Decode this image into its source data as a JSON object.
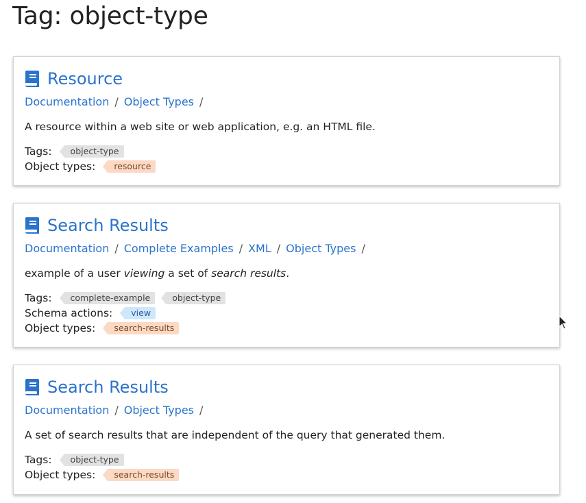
{
  "page": {
    "title": "Tag: object-type"
  },
  "cards": [
    {
      "icon": "book-icon",
      "title": "Resource",
      "breadcrumb": [
        "Documentation",
        "Object Types"
      ],
      "description": "A resource within a web site or web application, e.g. an HTML file.",
      "tags_label": "Tags:",
      "tags": [
        "object-type"
      ],
      "object_types_label": "Object types:",
      "object_types": [
        "resource"
      ]
    },
    {
      "icon": "book-icon",
      "title": "Search Results",
      "breadcrumb": [
        "Documentation",
        "Complete Examples",
        "XML",
        "Object Types"
      ],
      "description_parts": {
        "p1": "example of a user ",
        "em1": "viewing",
        "p2": " a set of ",
        "em2": "search results",
        "p3": "."
      },
      "tags_label": "Tags:",
      "tags": [
        "complete-example",
        "object-type"
      ],
      "schema_actions_label": "Schema actions:",
      "schema_actions": [
        "view"
      ],
      "object_types_label": "Object types:",
      "object_types": [
        "search-results"
      ]
    },
    {
      "icon": "book-icon",
      "title": "Search Results",
      "breadcrumb": [
        "Documentation",
        "Object Types"
      ],
      "description": "A set of search results that are independent of the query that generated them.",
      "tags_label": "Tags:",
      "tags": [
        "object-type"
      ],
      "object_types_label": "Object types:",
      "object_types": [
        "search-results"
      ]
    }
  ],
  "breadcrumb_separator": "/",
  "colors": {
    "link": "#2a73cc",
    "tag_gray": "#e2e2e2",
    "tag_orange": "#fbd9c4",
    "tag_blue": "#cfe7fb"
  }
}
